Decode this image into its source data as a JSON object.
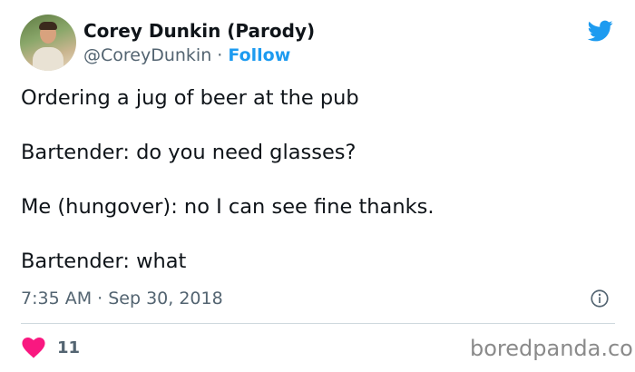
{
  "tweet": {
    "author_name": "Corey Dunkin (Parody)",
    "handle": "@CoreyDunkin",
    "separator": " · ",
    "follow_label": "Follow",
    "lines": [
      "Ordering a jug of beer at the pub",
      "Bartender: do you need glasses?",
      "Me (hungover): no I can see fine thanks.",
      "Bartender: what"
    ],
    "timestamp": "7:35 AM · Sep 30, 2018",
    "like_count": "11"
  },
  "watermark": "boredpanda.com",
  "icons": {
    "brand": "twitter-bird-icon",
    "info": "info-icon",
    "like": "heart-icon"
  },
  "colors": {
    "twitter_blue": "#1d9bf0",
    "heart_pink": "#f91880",
    "muted_text": "#536471"
  }
}
